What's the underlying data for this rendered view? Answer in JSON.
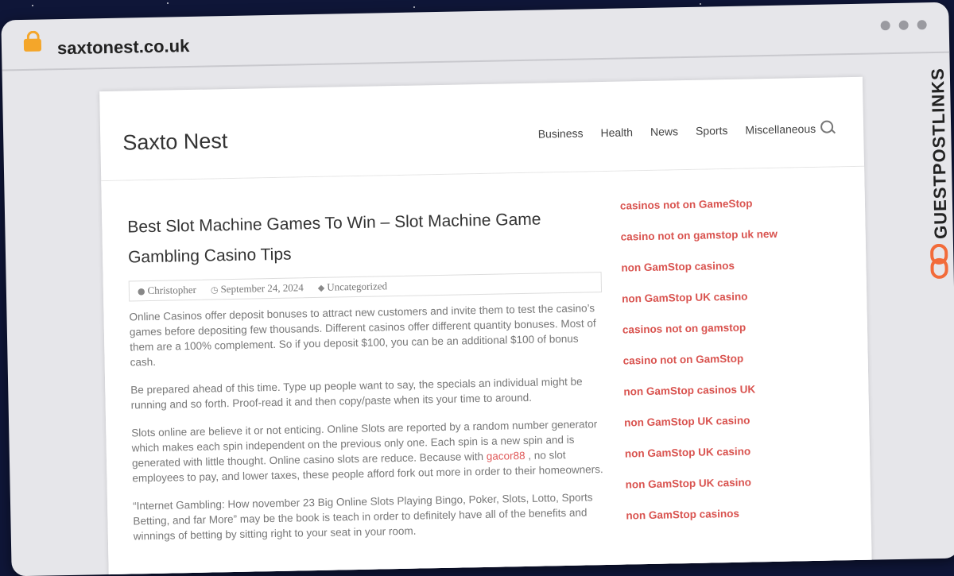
{
  "browser": {
    "url": "saxtonest.co.uk",
    "watermark": "GUESTPOSTLINKS"
  },
  "site": {
    "title": "Saxto Nest",
    "nav": [
      "Business",
      "Health",
      "News",
      "Sports",
      "Miscellaneous"
    ]
  },
  "post": {
    "title": "Best Slot Machine Games To Win – Slot Machine Game Gambling Casino Tips",
    "author": "Christopher",
    "date": "September 24, 2024",
    "category": "Uncategorized",
    "p1": "Online Casinos offer deposit bonuses to attract new customers and invite them to test the casino’s games before depositing few thousands. Different casinos offer different quantity bonuses. Most of them are a 100% complement. So if you deposit $100, you can be an additional $100 of bonus cash.",
    "p2": "Be prepared ahead of this time. Type up people want to say, the specials an individual might be running and so forth. Proof-read it and then copy/paste when its your time to around.",
    "p3_before": "Slots online are believe it or not enticing. Online Slots are reported by a random number generator which makes each spin independent on the previous only one. Each spin is a new spin and is generated with little thought. Online casino slots are reduce. Because with ",
    "p3_link": "gacor88",
    "p3_after": " , no slot employees to pay, and lower taxes, these people afford fork out more in order to their homeowners.",
    "p4": "“Internet Gambling: How november 23 Big Online Slots Playing Bingo, Poker, Slots, Lotto, Sports Betting, and far More” may be the book is teach in order to definitely have all of the benefits and winnings of betting by sitting right to your seat in your room."
  },
  "sidebar": {
    "links": [
      "casinos not on GameStop",
      "casino not on gamstop uk new",
      "non GamStop casinos",
      "non GamStop UK casino",
      "casinos not on gamstop",
      "casino not on GamStop",
      "non GamStop casinos UK",
      "non GamStop UK casino",
      "non GamStop UK casino",
      "non GamStop UK casino",
      "non GamStop casinos"
    ]
  },
  "colors": {
    "background": "#0f1638",
    "link": "#d9534f",
    "lock": "#f4a62a",
    "watermark_logo": "#f26b3a"
  }
}
